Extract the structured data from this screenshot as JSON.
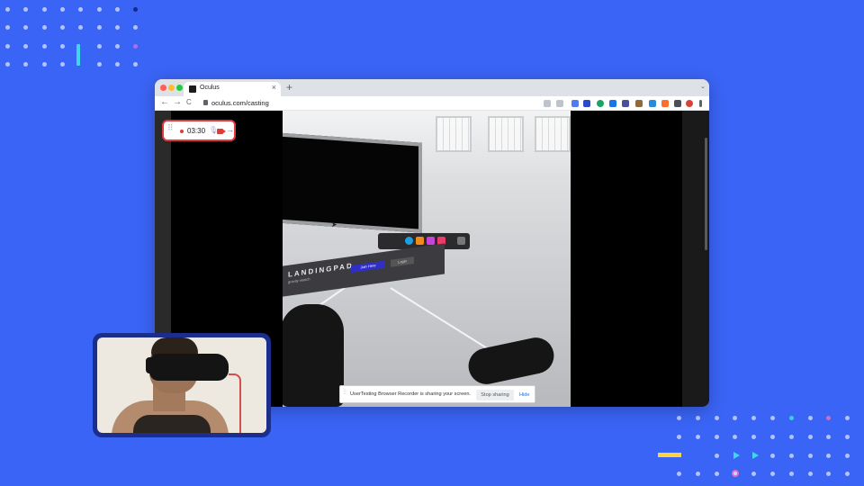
{
  "browser": {
    "tab": {
      "title": "Oculus",
      "close": "×"
    },
    "new_tab": "+",
    "tab_menu": "⌄",
    "nav": {
      "back": "←",
      "forward": "→",
      "reload": "C"
    },
    "url": "oculus.com/casting"
  },
  "recorder": {
    "grip": "⠿",
    "timer": "03:30",
    "mic_icon": "mic-icon",
    "camera_icon": "camera-icon",
    "arrow": "→",
    "accent": "#e03a3a"
  },
  "vr": {
    "panel_title": "LANDINGPAD",
    "panel_subtitle": "gravity sketch",
    "join_label": "Join Here",
    "login_label": "Login"
  },
  "share_bar": {
    "grip": "⁞",
    "message": "UserTesting Browser Recorder is sharing your screen.",
    "stop_label": "Stop sharing",
    "hide_label": "Hide"
  },
  "colors": {
    "background": "#3a64f5",
    "link_blue": "#1a73e8"
  }
}
